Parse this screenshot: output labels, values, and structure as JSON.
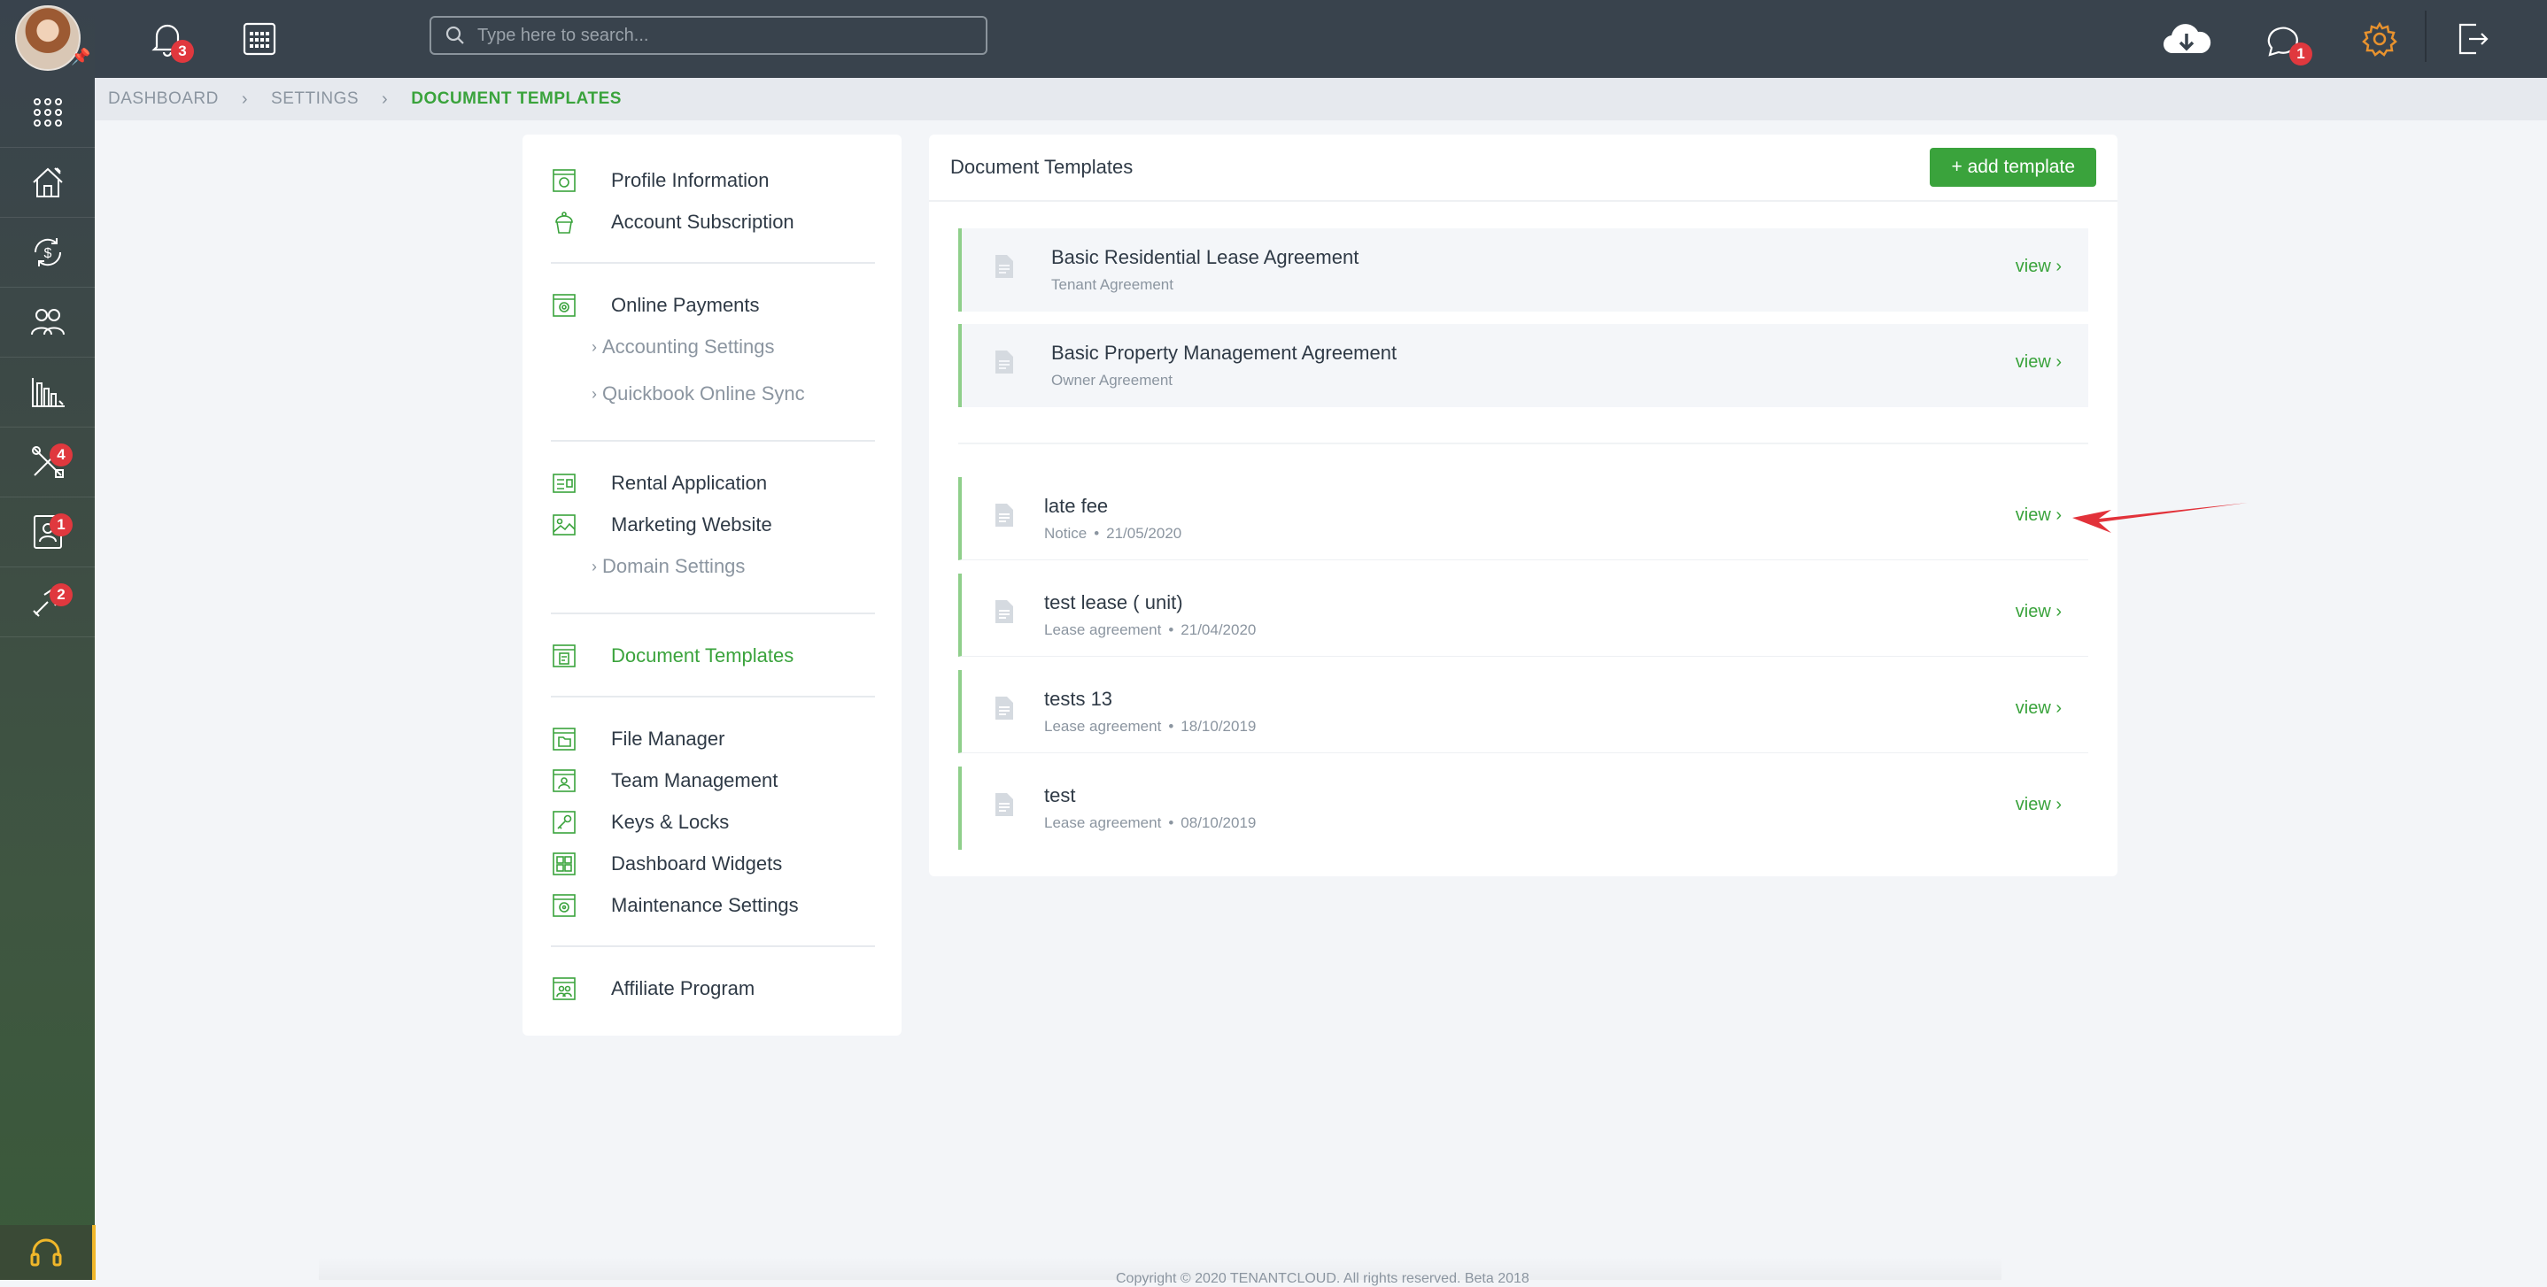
{
  "topbar": {
    "notifications_count": "3",
    "search_placeholder": "Type here to search...",
    "messages_count": "1"
  },
  "sidebar": {
    "badges": {
      "maintenance": "4",
      "tenants": "1",
      "integrations": "2"
    }
  },
  "breadcrumb": {
    "items": [
      "DASHBOARD",
      "SETTINGS"
    ],
    "current": "DOCUMENT TEMPLATES"
  },
  "settings_nav": {
    "profile_information": "Profile Information",
    "account_subscription": "Account Subscription",
    "online_payments": "Online Payments",
    "accounting_settings": "Accounting Settings",
    "quickbook_online_sync": "Quickbook Online Sync",
    "rental_application": "Rental Application",
    "marketing_website": "Marketing Website",
    "domain_settings": "Domain Settings",
    "document_templates": "Document Templates",
    "file_manager": "File Manager",
    "team_management": "Team Management",
    "keys_locks": "Keys & Locks",
    "dashboard_widgets": "Dashboard Widgets",
    "maintenance_settings": "Maintenance Settings",
    "affiliate_program": "Affiliate Program"
  },
  "document_templates": {
    "title": "Document Templates",
    "add_button": "+ add template",
    "view_label": "view",
    "base_templates": [
      {
        "name": "Basic Residential Lease Agreement",
        "type": "Tenant Agreement"
      },
      {
        "name": "Basic Property Management Agreement",
        "type": "Owner Agreement"
      }
    ],
    "user_templates": [
      {
        "name": "late fee",
        "type": "Notice",
        "date": "21/05/2020"
      },
      {
        "name": "test lease ( unit)",
        "type": "Lease agreement",
        "date": "21/04/2020"
      },
      {
        "name": "tests 13",
        "type": "Lease agreement",
        "date": "18/10/2019"
      },
      {
        "name": "test",
        "type": "Lease agreement",
        "date": "08/10/2019"
      }
    ]
  },
  "footer": {
    "text": "Copyright © 2020 TENANTCLOUD. All rights reserved. Beta 2018"
  },
  "colors": {
    "accent": "#3aa33c",
    "topbar": "#39434d",
    "badge": "#e0383e",
    "arrow": "#e2323a"
  },
  "icons": {
    "topbar": [
      "bell-icon",
      "calendar-icon",
      "search-icon",
      "cloud-download-icon",
      "chat-icon",
      "gear-icon",
      "logout-icon"
    ],
    "sidebar": [
      "apps-grid-icon",
      "home-icon",
      "money-cycle-icon",
      "people-icon",
      "bar-chart-icon",
      "tools-icon",
      "tenant-card-icon",
      "link-icon",
      "headset-icon"
    ]
  }
}
